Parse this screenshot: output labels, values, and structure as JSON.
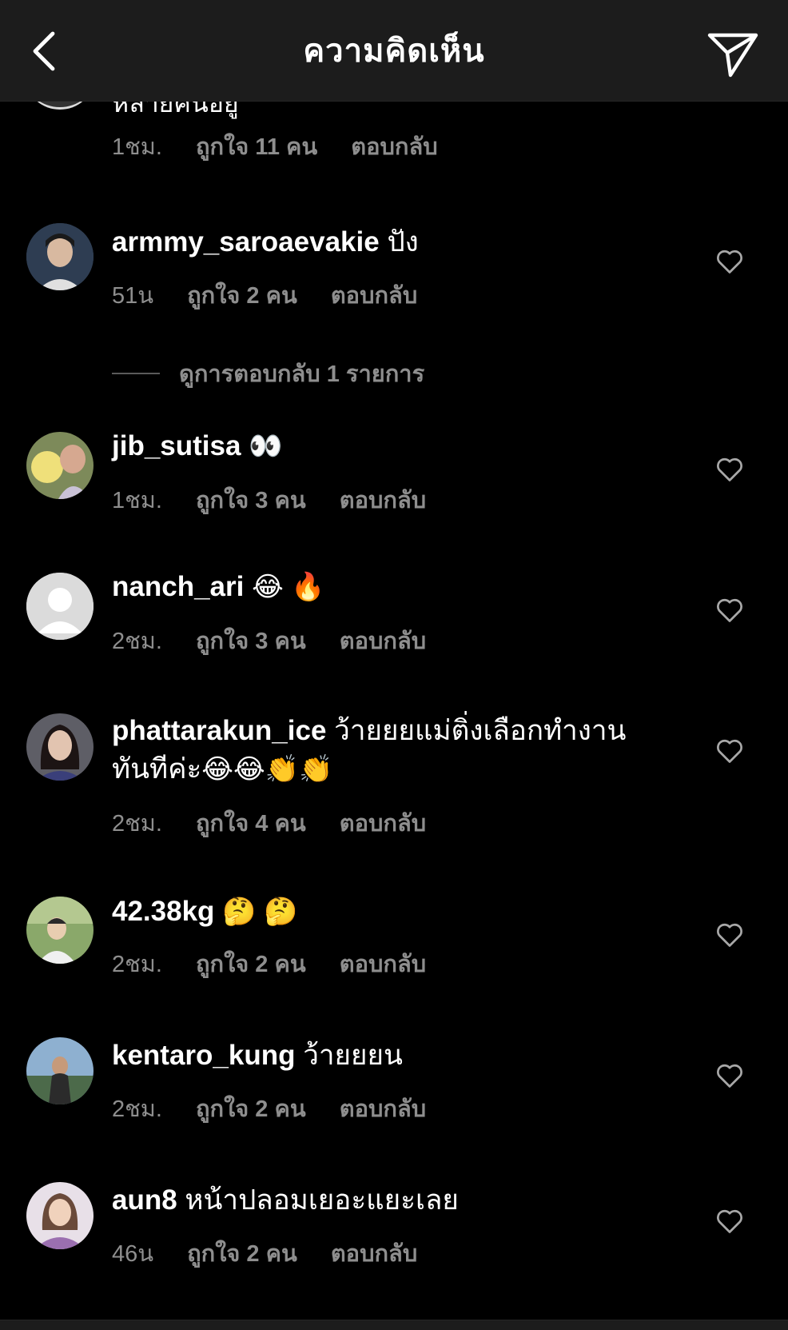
{
  "header": {
    "title": "ความคิดเห็น",
    "back_icon": "chevron-left-icon",
    "send_icon": "paper-plane-icon"
  },
  "partial_comment": {
    "text": "หลายคนอยู่",
    "time": "1ชม.",
    "likes": "ถูกใจ 11 คน",
    "reply": "ตอบกลับ"
  },
  "view_replies": "ดูการตอบกลับ 1 รายการ",
  "comments": [
    {
      "username": "armmy_saroaevakie",
      "text": " ปัง",
      "emoji": "",
      "time": "51น",
      "likes": "ถูกใจ 2 คน",
      "reply": "ตอบกลับ",
      "avatar_color": "#3a4a5e"
    },
    {
      "username": "jib_sutisa",
      "text": " ",
      "emoji": "👀",
      "time": "1ชม.",
      "likes": "ถูกใจ 3 คน",
      "reply": "ตอบกลับ",
      "avatar_color": "#c9a24a"
    },
    {
      "username": "nanch_ari",
      "text": " ",
      "emoji": "😂 🔥",
      "time": "2ชม.",
      "likes": "ถูกใจ 3 คน",
      "reply": "ตอบกลับ",
      "avatar_color": "#dbdbdb"
    },
    {
      "username": "phattarakun_ice",
      "text": " ว้ายยยแม่ติ่งเลือกทำงานทันทีค่ะ",
      "emoji": "😂😂👏👏",
      "time": "2ชม.",
      "likes": "ถูกใจ 4 คน",
      "reply": "ตอบกลับ",
      "avatar_color": "#6b5a6b"
    },
    {
      "username": "42.38kg",
      "text": " ",
      "emoji": "🤔 🤔",
      "time": "2ชม.",
      "likes": "ถูกใจ 2 คน",
      "reply": "ตอบกลับ",
      "avatar_color": "#6f8a5c"
    },
    {
      "username": "kentaro_kung",
      "text": " ว้ายยยน",
      "emoji": "",
      "time": "2ชม.",
      "likes": "ถูกใจ 2 คน",
      "reply": "ตอบกลับ",
      "avatar_color": "#6f8fb0"
    },
    {
      "username": "aun8",
      "text": " หน้าปลอมเยอะแยะเลย",
      "emoji": "",
      "time": "46น",
      "likes": "ถูกใจ 2 คน",
      "reply": "ตอบกลับ",
      "avatar_color": "#b89ab0"
    }
  ],
  "icons": {
    "like": "heart-outline-icon"
  },
  "colors": {
    "background": "#000000",
    "header_bg": "#1c1c1c",
    "muted_text": "#8e8e8e"
  }
}
